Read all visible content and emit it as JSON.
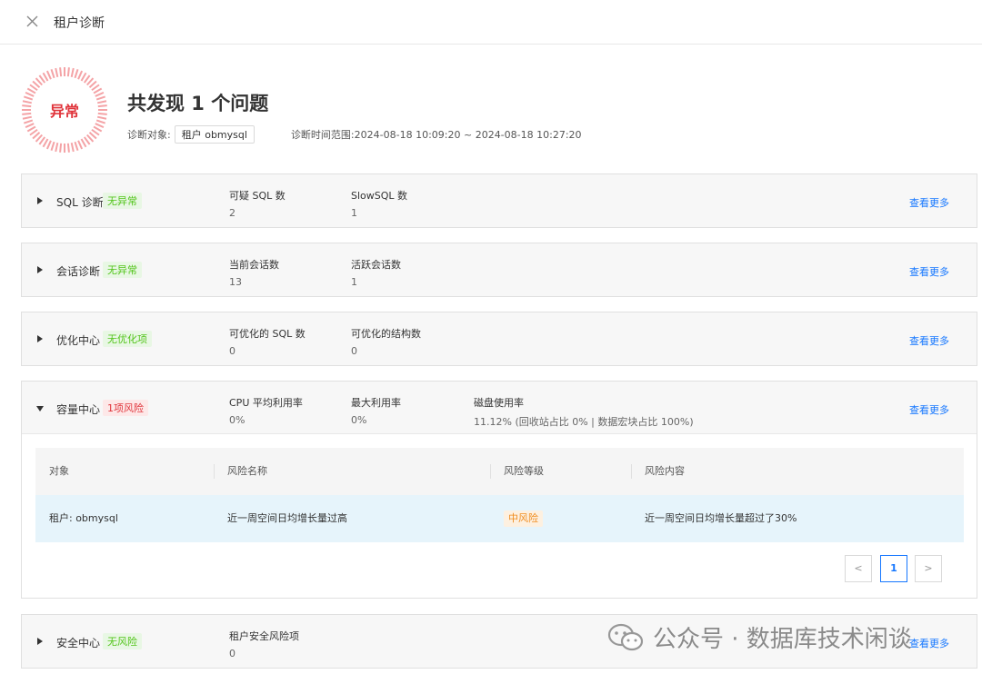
{
  "header": {
    "title": "租户诊断"
  },
  "summary": {
    "status": "异常",
    "headline": "共发现 1 个问题",
    "target_label": "诊断对象:",
    "target_value": "租户  obmysql",
    "time_label": "诊断时间范围:",
    "time_range": "2024-08-18 10:09:20 ~ 2024-08-18 10:27:20"
  },
  "more_label": "查看更多",
  "sections": {
    "sql": {
      "name": "SQL 诊断",
      "badge": "无异常",
      "metrics": [
        {
          "label": "可疑 SQL 数",
          "value": "2"
        },
        {
          "label": "SlowSQL 数",
          "value": "1"
        }
      ]
    },
    "session": {
      "name": "会话诊断",
      "badge": "无异常",
      "metrics": [
        {
          "label": "当前会话数",
          "value": "13"
        },
        {
          "label": "活跃会话数",
          "value": "1"
        }
      ]
    },
    "optimize": {
      "name": "优化中心",
      "badge": "无优化项",
      "metrics": [
        {
          "label": "可优化的 SQL 数",
          "value": "0"
        },
        {
          "label": "可优化的结构数",
          "value": "0"
        }
      ]
    },
    "capacity": {
      "name": "容量中心",
      "badge": "1项风险",
      "metrics": [
        {
          "label": "CPU 平均利用率",
          "value": "0%"
        },
        {
          "label": "最大利用率",
          "value": "0%"
        },
        {
          "label": "磁盘使用率",
          "value": "11.12% (回收站占比 0% | 数据宏块占比 100%)"
        }
      ],
      "table": {
        "columns": [
          "对象",
          "风险名称",
          "风险等级",
          "风险内容"
        ],
        "rows": [
          {
            "object": "租户: obmysql",
            "name": "近一周空间日均增长量过高",
            "level": "中风险",
            "content": "近一周空间日均增长量超过了30%"
          }
        ]
      },
      "pagination": {
        "prev": "<",
        "current": "1",
        "next": ">"
      }
    },
    "security": {
      "name": "安全中心",
      "badge": "无风险",
      "metrics": [
        {
          "label": "租户安全风险项",
          "value": "0"
        }
      ]
    }
  },
  "watermark": "公众号 · 数据库技术闲谈",
  "colors": {
    "danger": "#e0343b",
    "success": "#52c41a",
    "link": "#1677ff",
    "warning": "#f08c1e"
  }
}
